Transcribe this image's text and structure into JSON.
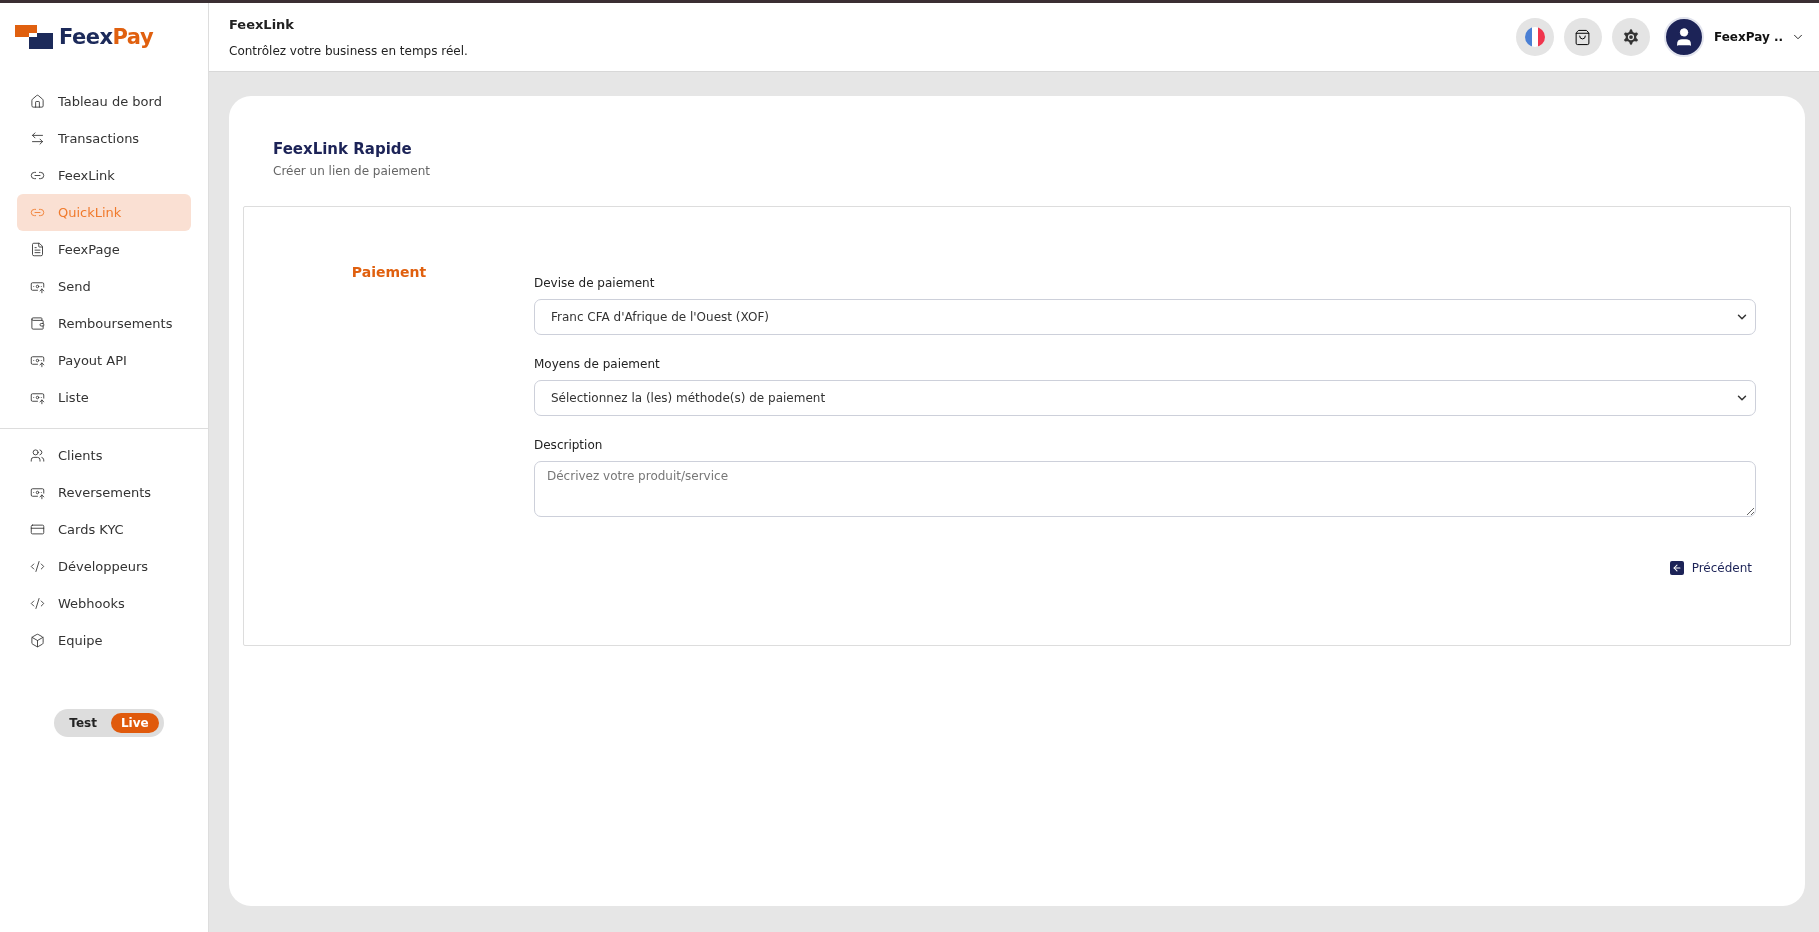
{
  "logo": {
    "dark": "Feex",
    "accent": "Pay"
  },
  "sidebar": {
    "groups": [
      [
        {
          "label": "Tableau de bord",
          "selected": false
        },
        {
          "label": "Transactions",
          "selected": false
        },
        {
          "label": "FeexLink",
          "selected": false
        },
        {
          "label": "QuickLink",
          "selected": true
        },
        {
          "label": "FeexPage",
          "selected": false
        },
        {
          "label": "Send",
          "selected": false
        },
        {
          "label": "Remboursements",
          "selected": false
        },
        {
          "label": "Payout API",
          "selected": false
        },
        {
          "label": "Liste",
          "selected": false
        }
      ],
      [
        {
          "label": "Clients",
          "selected": false
        },
        {
          "label": "Reversements",
          "selected": false
        },
        {
          "label": "Cards KYC",
          "selected": false
        },
        {
          "label": "Développeurs",
          "selected": false
        },
        {
          "label": "Webhooks",
          "selected": false
        },
        {
          "label": "Equipe",
          "selected": false
        }
      ]
    ],
    "mode_toggle": [
      {
        "label": "Test",
        "selected": false
      },
      {
        "label": "Live",
        "selected": true
      }
    ]
  },
  "header": {
    "title": "FeexLink",
    "subtitle": "Contrôlez votre business en temps réel.",
    "user": "FeexPay .."
  },
  "card": {
    "title": "FeexLink Rapide",
    "subtitle": "Créer un lien de paiement",
    "section": "Paiement",
    "fields": [
      {
        "kind": "select",
        "label": "Devise de paiement",
        "value": "Franc CFA d'Afrique de l'Ouest (XOF)"
      },
      {
        "kind": "select",
        "label": "Moyens de paiement",
        "value": "Sélectionnez la (les) méthode(s) de paiement"
      },
      {
        "kind": "textarea",
        "label": "Description",
        "placeholder": "Décrivez votre produit/service"
      }
    ],
    "back_button": "Précédent"
  }
}
